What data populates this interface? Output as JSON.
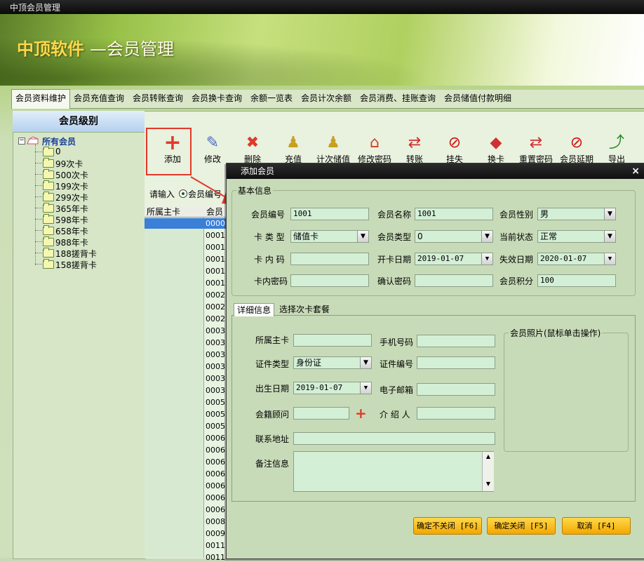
{
  "window_title": "中顶会员管理",
  "banner": {
    "title": "中顶软件",
    "subtitle": "—会员管理"
  },
  "tabs": [
    "会员资料维护",
    "会员充值查询",
    "会员转账查询",
    "会员换卡查询",
    "余额一览表",
    "会员计次余额",
    "会员消费、挂账查询",
    "会员储值付款明细"
  ],
  "active_tab": 0,
  "level_panel": {
    "title": "会员级别",
    "root": "所有会员",
    "items": [
      "0",
      "99次卡",
      "500次卡",
      "199次卡",
      "299次卡",
      "365年卡",
      "598年卡",
      "658年卡",
      "988年卡",
      "188搓背卡",
      "158搓背卡"
    ]
  },
  "toolbar": {
    "buttons": [
      {
        "label": "添加",
        "icon": "plus-icon",
        "color": "#e03a2a"
      },
      {
        "label": "修改",
        "icon": "wrench-icon",
        "color": "#4a6ac0"
      },
      {
        "label": "删除",
        "icon": "x-icon",
        "color": "#e03a2a"
      },
      {
        "label": "充值",
        "icon": "pawn-icon",
        "color": "#c8a020"
      },
      {
        "label": "计次储值",
        "icon": "pawn-icon",
        "color": "#c8a020"
      },
      {
        "label": "修改密码",
        "icon": "house-icon",
        "color": "#d04020"
      },
      {
        "label": "转账",
        "icon": "arrows-icon",
        "color": "#d03030"
      },
      {
        "label": "挂失",
        "icon": "no-icon",
        "color": "#d01010"
      },
      {
        "label": "换卡",
        "icon": "diamond-icon",
        "color": "#d03030"
      },
      {
        "label": "重置密码",
        "icon": "arrows-icon",
        "color": "#d03030"
      },
      {
        "label": "会员延期",
        "icon": "no-icon",
        "color": "#d01010"
      },
      {
        "label": "导出",
        "icon": "export-icon",
        "color": "#2a8a2a"
      }
    ]
  },
  "search": {
    "prompt": "请输入",
    "radio_label": "会员编号"
  },
  "grid": {
    "headers": [
      "所属主卡",
      "会员"
    ],
    "rows": [
      "0000",
      "0001",
      "0001",
      "0001",
      "0001",
      "0001",
      "0002",
      "0002",
      "0002",
      "0003",
      "0003",
      "0003",
      "0003",
      "0003",
      "0003",
      "0005",
      "0005",
      "0005",
      "0006",
      "0006",
      "0006",
      "0006",
      "0006",
      "0006",
      "0006",
      "0008",
      "0009",
      "0011",
      "0011"
    ]
  },
  "dialog": {
    "title": "添加会员",
    "close": "×",
    "basic_group": "基本信息",
    "fields": {
      "member_no": {
        "label": "会员编号",
        "value": "1001"
      },
      "member_name": {
        "label": "会员名称",
        "value": "1001"
      },
      "gender": {
        "label": "会员性别",
        "value": "男"
      },
      "card_type": {
        "label": "卡 类 型",
        "value": "储值卡"
      },
      "member_type": {
        "label": "会员类型",
        "value": "0"
      },
      "status": {
        "label": "当前状态",
        "value": "正常"
      },
      "card_code": {
        "label": "卡 内 码",
        "value": ""
      },
      "open_date": {
        "label": "开卡日期",
        "value": "2019-01-07"
      },
      "expire_date": {
        "label": "失效日期",
        "value": "2020-01-07"
      },
      "card_pwd": {
        "label": "卡内密码",
        "value": ""
      },
      "confirm_pwd": {
        "label": "确认密码",
        "value": ""
      },
      "points": {
        "label": "会员积分",
        "value": "100"
      }
    },
    "detail_tabs": [
      "详细信息",
      "选择次卡套餐"
    ],
    "detail": {
      "main_card": {
        "label": "所属主卡",
        "value": ""
      },
      "phone": {
        "label": "手机号码",
        "value": ""
      },
      "id_type": {
        "label": "证件类型",
        "value": "身份证"
      },
      "id_no": {
        "label": "证件编号",
        "value": ""
      },
      "birth": {
        "label": "出生日期",
        "value": "2019-01-07"
      },
      "email": {
        "label": "电子邮箱",
        "value": ""
      },
      "advisor": {
        "label": "会籍顾问",
        "value": ""
      },
      "referrer": {
        "label": "介 绍 人",
        "value": ""
      },
      "address": {
        "label": "联系地址",
        "value": ""
      },
      "remark": {
        "label": "备注信息",
        "value": ""
      },
      "photo_group": "会员照片(鼠标单击操作)"
    },
    "buttons": {
      "save_keep": "确定不关闭 [F6]",
      "save_close": "确定关闭 [F5]",
      "cancel": "取消 [F4]"
    }
  }
}
